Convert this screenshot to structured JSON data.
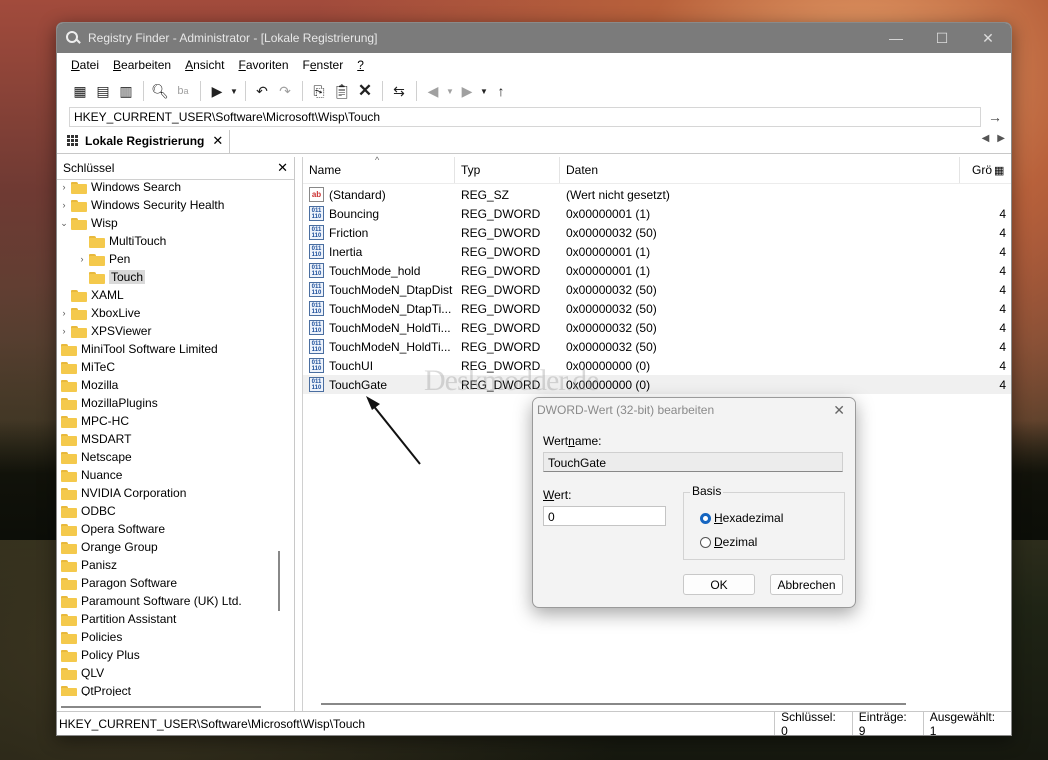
{
  "window": {
    "title": "Registry Finder - Administrator - [Lokale Registrierung]",
    "controls": {
      "minimize": "—",
      "maximize": "☐",
      "close": "✕"
    }
  },
  "menu": [
    {
      "label": "Datei",
      "u": "D",
      "rest": "atei"
    },
    {
      "label": "Bearbeiten",
      "u": "B",
      "rest": "earbeiten"
    },
    {
      "label": "Ansicht",
      "u": "A",
      "rest": "nsicht"
    },
    {
      "label": "Favoriten",
      "u": "F",
      "rest": "avoriten"
    },
    {
      "label": "Fenster",
      "u": "e",
      "pre": "F",
      "rest": "nster"
    },
    {
      "label": "?",
      "u": "?",
      "rest": ""
    }
  ],
  "toolbar_icons": [
    "new-window-icon",
    "new-tab-icon",
    "registry-icon",
    "find-icon",
    "replace-icon",
    "export-icon",
    "undo-icon",
    "redo-icon",
    "copy-icon",
    "paste-icon",
    "delete-icon",
    "refresh-icon",
    "back-icon",
    "forward-icon",
    "up-icon"
  ],
  "address": {
    "value": "HKEY_CURRENT_USER\\Software\\Microsoft\\Wisp\\Touch",
    "go": "→"
  },
  "tab": {
    "label": "Lokale Registrierung",
    "close": "✕"
  },
  "left_pane": {
    "header": "Schlüssel",
    "close": "✕",
    "tree": [
      {
        "label": "Windows Search",
        "indent": 1,
        "expander": "›"
      },
      {
        "label": "Windows Security Health",
        "indent": 1,
        "expander": "›"
      },
      {
        "label": "Wisp",
        "indent": 1,
        "expander": "⌄",
        "open": true
      },
      {
        "label": "MultiTouch",
        "indent": 2,
        "expander": ""
      },
      {
        "label": "Pen",
        "indent": 2,
        "expander": "›"
      },
      {
        "label": "Touch",
        "indent": 2,
        "expander": "",
        "selected": true
      },
      {
        "label": "XAML",
        "indent": 1,
        "expander": ""
      },
      {
        "label": "XboxLive",
        "indent": 1,
        "expander": "›"
      },
      {
        "label": "XPSViewer",
        "indent": 1,
        "expander": "›"
      },
      {
        "label": "MiniTool Software Limited",
        "indent": 0,
        "expander": ""
      },
      {
        "label": "MiTeC",
        "indent": 0,
        "expander": ""
      },
      {
        "label": "Mozilla",
        "indent": 0,
        "expander": ""
      },
      {
        "label": "MozillaPlugins",
        "indent": 0,
        "expander": ""
      },
      {
        "label": "MPC-HC",
        "indent": 0,
        "expander": ""
      },
      {
        "label": "MSDART",
        "indent": 0,
        "expander": ""
      },
      {
        "label": "Netscape",
        "indent": 0,
        "expander": ""
      },
      {
        "label": "Nuance",
        "indent": 0,
        "expander": ""
      },
      {
        "label": "NVIDIA Corporation",
        "indent": 0,
        "expander": ""
      },
      {
        "label": "ODBC",
        "indent": 0,
        "expander": ""
      },
      {
        "label": "Opera Software",
        "indent": 0,
        "expander": ""
      },
      {
        "label": "Orange Group",
        "indent": 0,
        "expander": ""
      },
      {
        "label": "Panisz",
        "indent": 0,
        "expander": ""
      },
      {
        "label": "Paragon Software",
        "indent": 0,
        "expander": ""
      },
      {
        "label": "Paramount Software (UK) Ltd.",
        "indent": 0,
        "expander": ""
      },
      {
        "label": "Partition Assistant",
        "indent": 0,
        "expander": ""
      },
      {
        "label": "Policies",
        "indent": 0,
        "expander": ""
      },
      {
        "label": "Policy Plus",
        "indent": 0,
        "expander": ""
      },
      {
        "label": "QLV",
        "indent": 0,
        "expander": ""
      },
      {
        "label": "QtProject",
        "indent": 0,
        "expander": ""
      }
    ]
  },
  "list": {
    "columns": {
      "name": "Name",
      "type": "Typ",
      "data": "Daten",
      "size": "Grö"
    },
    "rows": [
      {
        "icon": "string",
        "name": "(Standard)",
        "type": "REG_SZ",
        "data": "(Wert nicht gesetzt)",
        "size": ""
      },
      {
        "icon": "binary",
        "name": "Bouncing",
        "type": "REG_DWORD",
        "data": "0x00000001 (1)",
        "size": "4"
      },
      {
        "icon": "binary",
        "name": "Friction",
        "type": "REG_DWORD",
        "data": "0x00000032 (50)",
        "size": "4"
      },
      {
        "icon": "binary",
        "name": "Inertia",
        "type": "REG_DWORD",
        "data": "0x00000001 (1)",
        "size": "4"
      },
      {
        "icon": "binary",
        "name": "TouchMode_hold",
        "type": "REG_DWORD",
        "data": "0x00000001 (1)",
        "size": "4"
      },
      {
        "icon": "binary",
        "name": "TouchModeN_DtapDist",
        "type": "REG_DWORD",
        "data": "0x00000032 (50)",
        "size": "4"
      },
      {
        "icon": "binary",
        "name": "TouchModeN_DtapTi...",
        "type": "REG_DWORD",
        "data": "0x00000032 (50)",
        "size": "4"
      },
      {
        "icon": "binary",
        "name": "TouchModeN_HoldTi...",
        "type": "REG_DWORD",
        "data": "0x00000032 (50)",
        "size": "4"
      },
      {
        "icon": "binary",
        "name": "TouchModeN_HoldTi...",
        "type": "REG_DWORD",
        "data": "0x00000032 (50)",
        "size": "4"
      },
      {
        "icon": "binary",
        "name": "TouchUI",
        "type": "REG_DWORD",
        "data": "0x00000000 (0)",
        "size": "4"
      },
      {
        "icon": "binary",
        "name": "TouchGate",
        "type": "REG_DWORD",
        "data": "0x00000000 (0)",
        "size": "4",
        "highlight": true
      }
    ]
  },
  "watermark": "Deskmodder.de",
  "status": {
    "path": "HKEY_CURRENT_USER\\Software\\Microsoft\\Wisp\\Touch",
    "keys": "Schlüssel: 0",
    "entries": "Einträge: 9",
    "selected": "Ausgewählt: 1"
  },
  "dialog": {
    "title": "DWORD-Wert (32-bit) bearbeiten",
    "close": "✕",
    "name_label_pre": "Wert",
    "name_label_u": "n",
    "name_label_post": "ame:",
    "name_value": "TouchGate",
    "value_label_u": "W",
    "value_label_post": "ert:",
    "value": "0",
    "basis_title": "Basis",
    "hex_u": "H",
    "hex_post": "exadezimal",
    "dec_u": "D",
    "dec_post": "ezimal",
    "selected_basis": "hex",
    "ok": "OK",
    "cancel": "Abbrechen"
  },
  "colors": {
    "titlebar": "#7b7b7b",
    "accent": "#1565c0",
    "folder": "#f4c94c"
  }
}
